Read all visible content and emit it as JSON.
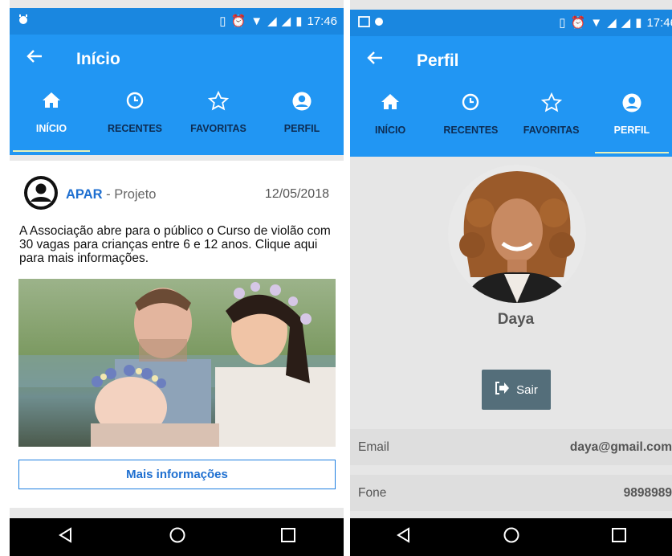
{
  "status_bar": {
    "time": "17:46"
  },
  "screen_home": {
    "title": "Início",
    "tabs": [
      {
        "label": "INÍCIO",
        "icon": "home-icon",
        "active": true
      },
      {
        "label": "RECENTES",
        "icon": "clock-icon",
        "active": false
      },
      {
        "label": "FAVORITAS",
        "icon": "star-icon",
        "active": false
      },
      {
        "label": "PERFIL",
        "icon": "account-icon",
        "active": false
      }
    ],
    "post": {
      "org_name": "APAR",
      "org_type": "- Projeto",
      "date": "12/05/2018",
      "text": "A Associação abre para o público o Curso de violão com 30 vagas para crianças entre 6 e 12 anos. Clique aqui para mais informações.",
      "button_label": "Mais informações"
    }
  },
  "screen_profile": {
    "title": "Perfil",
    "tabs": [
      {
        "label": "INÍCIO",
        "icon": "home-icon",
        "active": false
      },
      {
        "label": "RECENTES",
        "icon": "clock-icon",
        "active": false
      },
      {
        "label": "FAVORITAS",
        "icon": "star-icon",
        "active": false
      },
      {
        "label": "PERFIL",
        "icon": "account-icon",
        "active": true
      }
    ],
    "user_name": "Daya",
    "logout_label": "Sair",
    "fields": [
      {
        "label": "Email",
        "value": "daya@gmail.com"
      },
      {
        "label": "Fone",
        "value": "9898989"
      }
    ]
  },
  "colors": {
    "primary": "#2196f3",
    "status_bar": "#1a87e0",
    "accent_underline": "#e7f1b9",
    "logout_button": "#546e7a"
  }
}
